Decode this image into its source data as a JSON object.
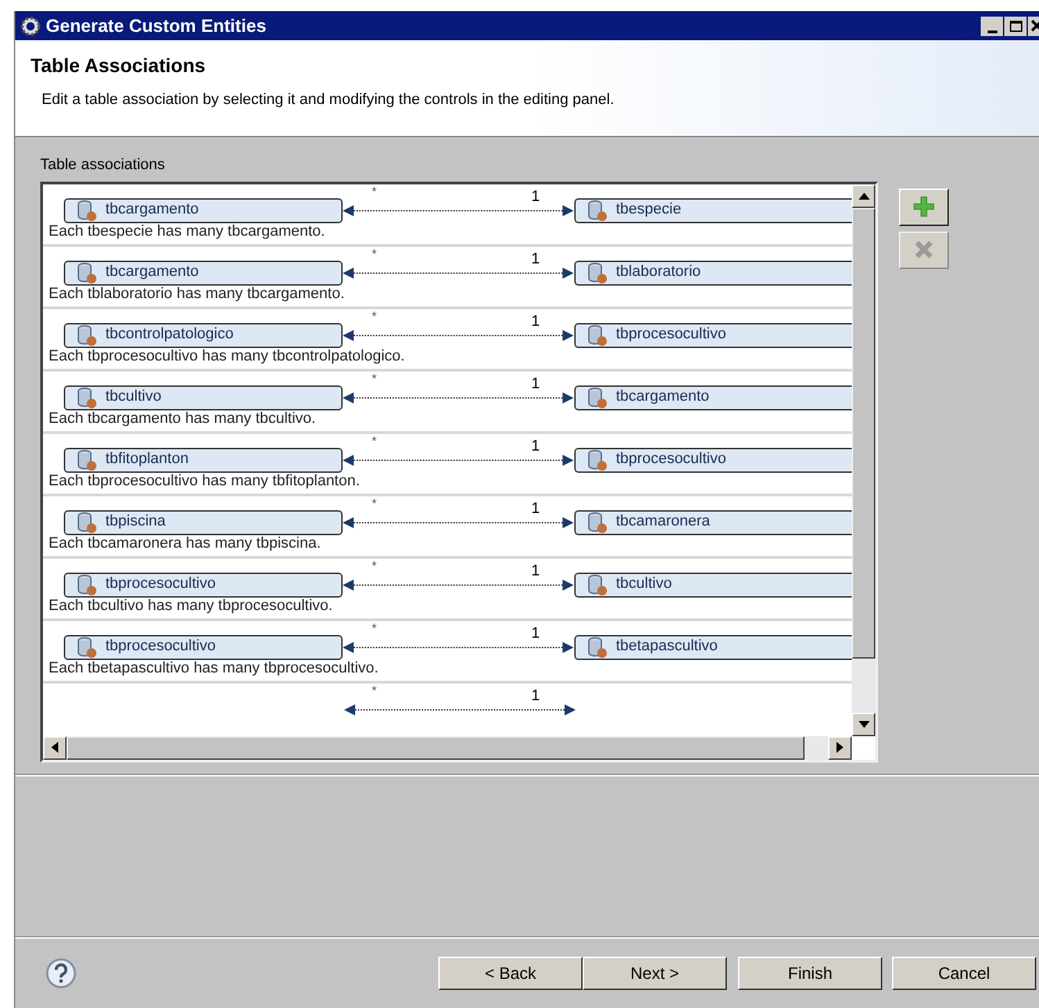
{
  "window": {
    "title": "Generate Custom Entities"
  },
  "header": {
    "title": "Table Associations",
    "description": "Edit a table association by selecting it and modifying the controls in the editing panel."
  },
  "associations": {
    "label": "Table associations",
    "rows": [
      {
        "many": "*",
        "one": "1",
        "left": "tbcargamento",
        "right": "tbespecie",
        "description": "Each tbespecie has many tbcargamento."
      },
      {
        "many": "*",
        "one": "1",
        "left": "tbcargamento",
        "right": "tblaboratorio",
        "description": "Each tblaboratorio has many tbcargamento."
      },
      {
        "many": "*",
        "one": "1",
        "left": "tbcontrolpatologico",
        "right": "tbprocesocultivo",
        "description": "Each tbprocesocultivo has many tbcontrolpatologico."
      },
      {
        "many": "*",
        "one": "1",
        "left": "tbcultivo",
        "right": "tbcargamento",
        "description": "Each tbcargamento has many tbcultivo."
      },
      {
        "many": "*",
        "one": "1",
        "left": "tbfitoplanton",
        "right": "tbprocesocultivo",
        "description": "Each tbprocesocultivo has many tbfitoplanton."
      },
      {
        "many": "*",
        "one": "1",
        "left": "tbpiscina",
        "right": "tbcamaronera",
        "description": "Each tbcamaronera has many tbpiscina."
      },
      {
        "many": "*",
        "one": "1",
        "left": "tbprocesocultivo",
        "right": "tbcultivo",
        "description": "Each tbcultivo has many tbprocesocultivo."
      },
      {
        "many": "*",
        "one": "1",
        "left": "tbprocesocultivo",
        "right": "tbetapascultivo",
        "description": "Each tbetapascultivo has many tbprocesocultivo."
      },
      {
        "many": "*",
        "one": "1"
      }
    ]
  },
  "side_buttons": [
    {
      "kind": "add",
      "disabled": false
    },
    {
      "kind": "remove",
      "disabled": true
    }
  ],
  "buttons": [
    {
      "label": "< Back"
    },
    {
      "label": "Next >"
    },
    {
      "label": "Finish"
    },
    {
      "label": "Cancel"
    }
  ]
}
